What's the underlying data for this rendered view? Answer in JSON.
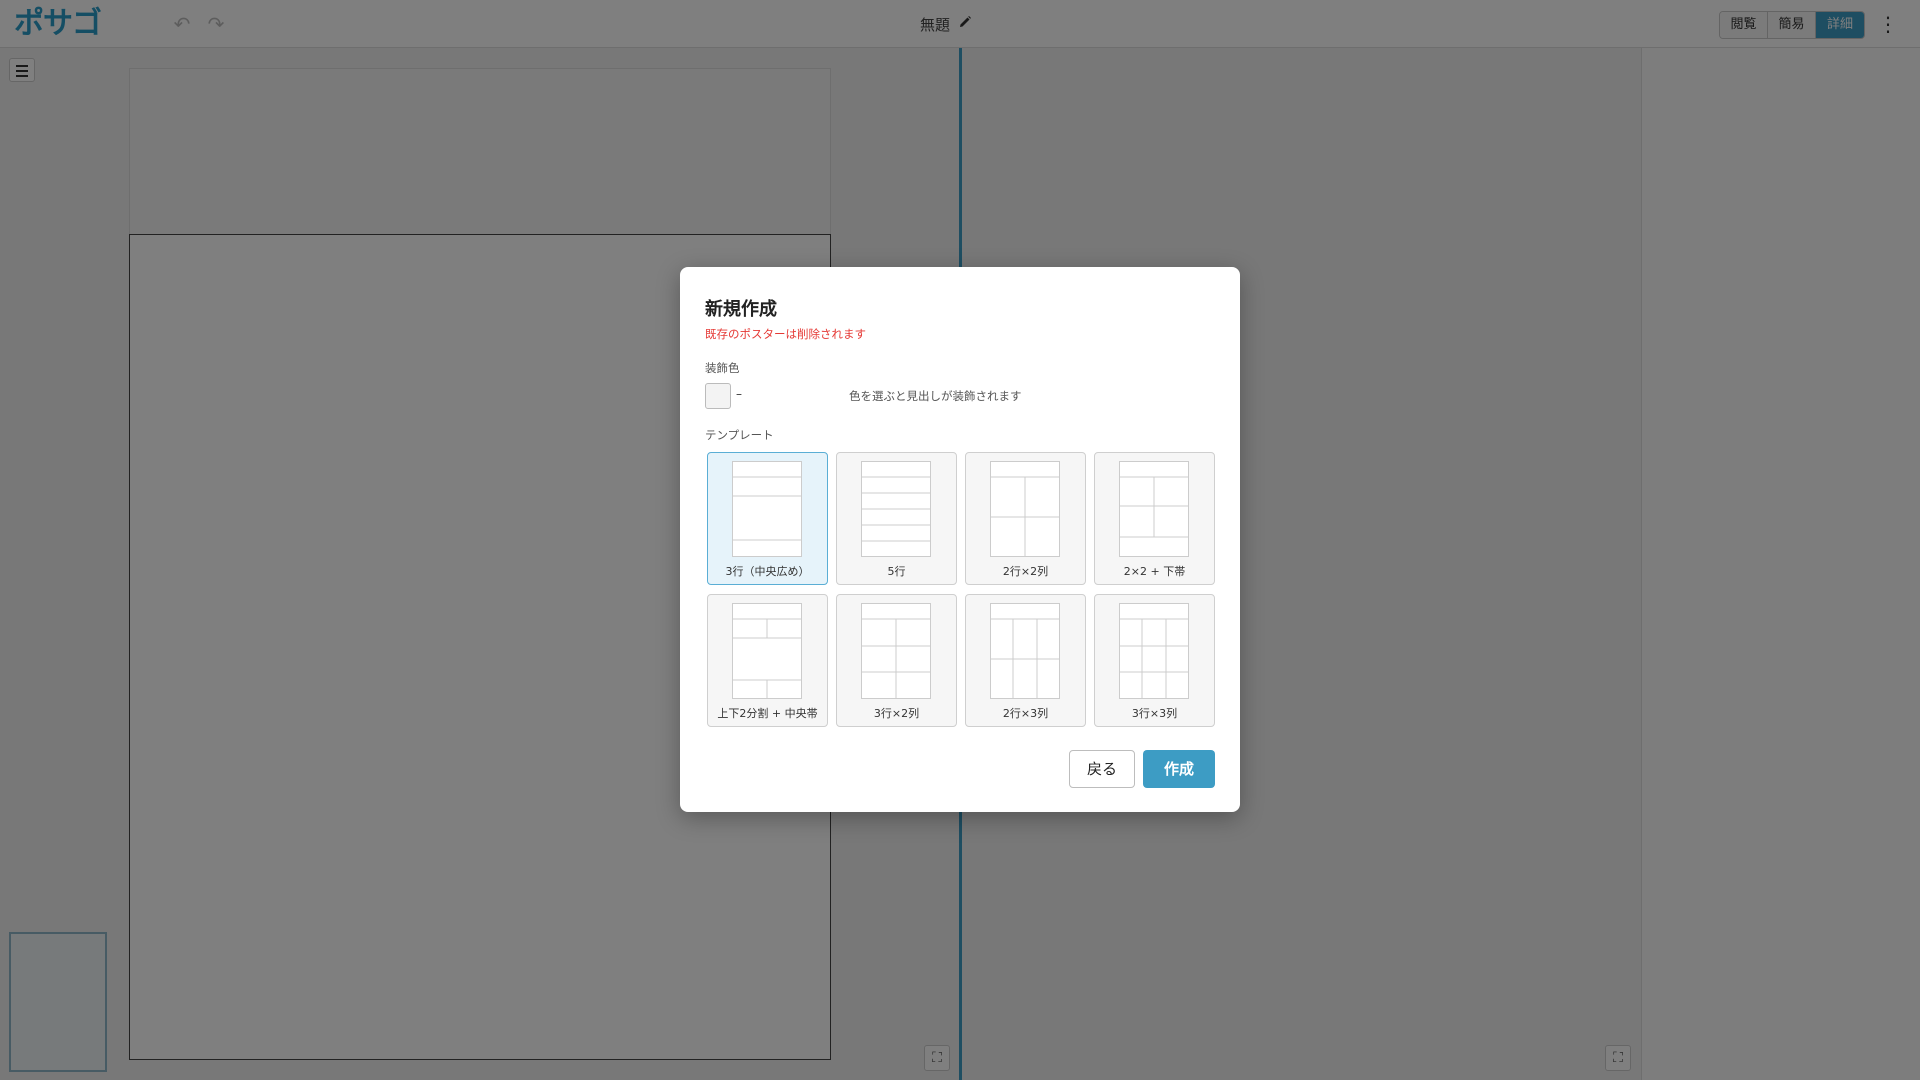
{
  "app": {
    "logo": "ポサゴ",
    "title": "無題"
  },
  "header": {
    "view_modes": [
      {
        "label": "閲覧",
        "active": false
      },
      {
        "label": "簡易",
        "active": false
      },
      {
        "label": "詳細",
        "active": true
      }
    ],
    "icons": [
      "undo-icon",
      "redo-icon",
      "pencil-icon",
      "kebab-menu-icon"
    ]
  },
  "colors": {
    "accent": "#3d9cc4",
    "warning": "#e53935",
    "selected_bg": "#e6f3fa"
  },
  "dialog": {
    "title": "新規作成",
    "warning": "既存のポスターは削除されます",
    "color_section": {
      "label": "装飾色",
      "value": "–",
      "hint": "色を選ぶと見出しが装飾されます"
    },
    "template_section": {
      "label": "テンプレート"
    },
    "templates": [
      {
        "label": "3行（中央広め）",
        "selected": true
      },
      {
        "label": "5行",
        "selected": false
      },
      {
        "label": "2行×2列",
        "selected": false
      },
      {
        "label": "2×2 + 下帯",
        "selected": false
      },
      {
        "label": "上下2分割 + 中央帯",
        "selected": false
      },
      {
        "label": "3行×2列",
        "selected": false
      },
      {
        "label": "2行×3列",
        "selected": false
      },
      {
        "label": "3行×3列",
        "selected": false
      }
    ],
    "buttons": {
      "back": "戻る",
      "create": "作成"
    }
  }
}
